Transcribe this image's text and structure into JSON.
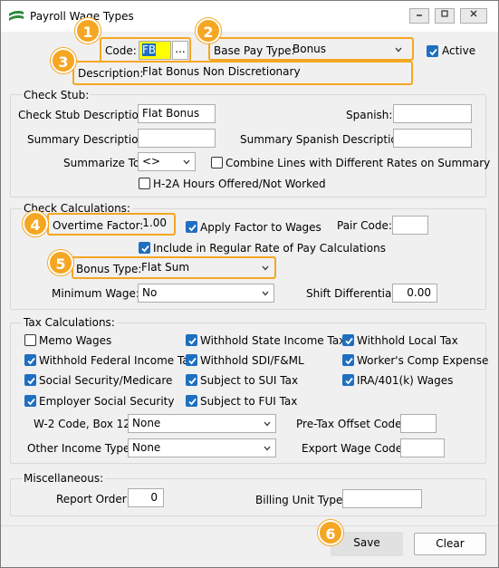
{
  "window": {
    "title": "Payroll Wage Types"
  },
  "header": {
    "code_label": "Code:",
    "code_value": "FB",
    "lookup_label": "...",
    "base_pay_label": "Base Pay Type:",
    "base_pay_value": "Bonus",
    "active_label": "Active",
    "description_label": "Description:",
    "description_value": "Flat Bonus Non Discretionary"
  },
  "check_stub": {
    "title": "Check Stub:",
    "stub_desc_label": "Check Stub Description:",
    "stub_desc_value": "Flat Bonus",
    "spanish_label": "Spanish:",
    "spanish_value": "",
    "summary_desc_label": "Summary Description:",
    "summary_desc_value": "",
    "summary_spanish_label": "Summary Spanish Description:",
    "summary_spanish_value": "",
    "summarize_label": "Summarize To:",
    "summarize_value": "<>",
    "combine_label": "Combine Lines with Different Rates on Summary",
    "h2a_label": "H-2A Hours Offered/Not Worked"
  },
  "check_calc": {
    "title": "Check Calculations:",
    "ot_label": "Overtime Factor:",
    "ot_value": "1.00",
    "apply_label": "Apply Factor to Wages",
    "pair_label": "Pair Code:",
    "pair_value": "",
    "include_label": "Include in Regular Rate of Pay Calculations",
    "bonus_label": "Bonus Type:",
    "bonus_value": "Flat Sum",
    "minwage_label": "Minimum Wage:",
    "minwage_value": "No",
    "shift_label": "Shift Differential:",
    "shift_value": "0.00"
  },
  "tax": {
    "title": "Tax Calculations:",
    "memo": "Memo Wages",
    "wh_state": "Withhold State Income Tax",
    "wh_local": "Withhold Local Tax",
    "wh_fed": "Withhold Federal Income Tax",
    "wh_sdi": "Withhold SDI/F&ML",
    "workers_comp": "Worker's Comp Expense",
    "ss_medicare": "Social Security/Medicare",
    "sui": "Subject to SUI Tax",
    "ira": "IRA/401(k) Wages",
    "employer_ss": "Employer Social Security",
    "fui": "Subject to FUI Tax",
    "w2_label": "W-2 Code, Box 12:",
    "w2_value": "None",
    "pretax_label": "Pre-Tax Offset Code:",
    "pretax_value": "",
    "other_label": "Other Income Type:",
    "other_value": "None",
    "export_label": "Export Wage Code:",
    "export_value": ""
  },
  "misc": {
    "title": "Miscellaneous:",
    "report_label": "Report Order:",
    "report_value": "0",
    "billing_label": "Billing Unit Type:",
    "billing_value": ""
  },
  "buttons": {
    "save": "Save",
    "clear": "Clear"
  },
  "callouts": [
    "1",
    "2",
    "3",
    "4",
    "5",
    "6"
  ],
  "colors": {
    "callout": "#f5a623",
    "checkbox": "#1e6fc0",
    "selection": "#ffff00"
  }
}
